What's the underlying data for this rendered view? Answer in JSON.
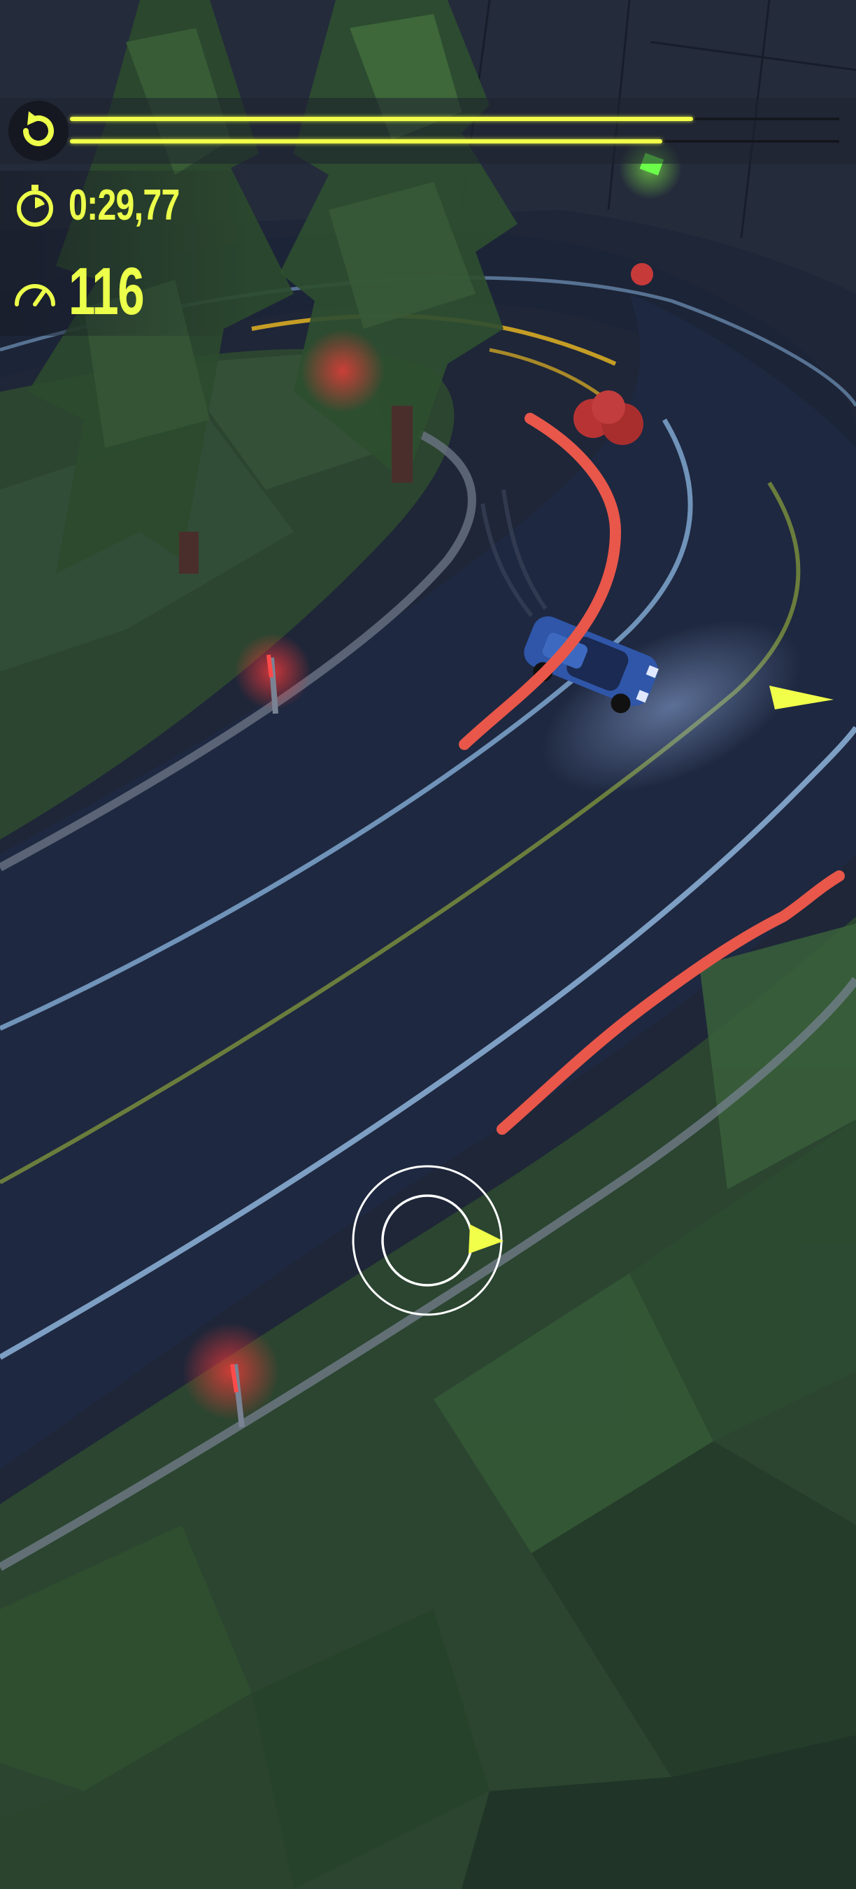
{
  "hud": {
    "timer": "0:29,77",
    "speed": "116",
    "progress": {
      "top_bar_fraction": 0.81,
      "bottom_bar_fraction": 0.77
    },
    "accent_color": "#ecff4a"
  },
  "icons": {
    "restart": "restart-icon",
    "timer": "stopwatch-icon",
    "speed": "speedometer-icon",
    "direction": "direction-arrow-icon"
  },
  "colors": {
    "track_asphalt": "#1e2840",
    "grass": "#2f4a2b",
    "lane_line": "#7fa6cf",
    "center_line": "#a9c23a",
    "drift_path": "#e8574a",
    "car_body": "#2f56a8"
  }
}
